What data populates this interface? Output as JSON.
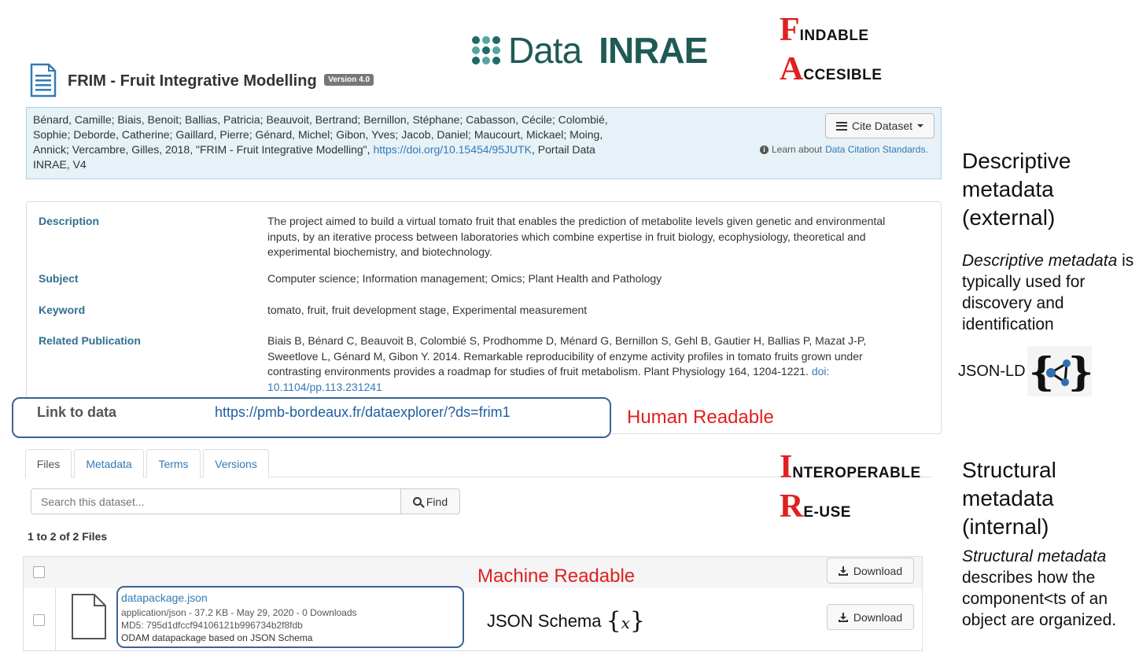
{
  "header": {
    "title": "FRIM - Fruit Integrative Modelling",
    "version": "Version 4.0",
    "logo_data": "Data",
    "logo_inrae": "INRAE"
  },
  "fair": {
    "findable_initial": "F",
    "findable_rest": "INDABLE",
    "accessible_initial": "A",
    "accessible_rest": "CCESIBLE",
    "interoperable_initial": "I",
    "interoperable_rest": "NTEROPERABLE",
    "reuse_initial": "R",
    "reuse_rest": "E-USE"
  },
  "citation": {
    "authors_text": "Bénard, Camille; Biais, Benoit; Ballias, Patricia; Beauvoit, Bertrand; Bernillon, Stéphane; Cabasson, Cécile; Colombié, Sophie; Deborde, Catherine; Gaillard, Pierre; Génard, Michel; Gibon, Yves; Jacob, Daniel; Maucourt, Mickael; Moing, Annick; Vercambre, Gilles, 2018, \"FRIM - Fruit Integrative Modelling\", ",
    "doi_link": "https://doi.org/10.15454/95JUTK",
    "suffix": ", Portail Data INRAE, V4",
    "cite_button": "Cite Dataset",
    "learn_prefix": "Learn about ",
    "learn_link": "Data Citation Standards."
  },
  "metadata": {
    "description_label": "Description",
    "description": "The project aimed to build a virtual tomato fruit that enables the prediction of metabolite levels given genetic and environmental inputs, by an iterative process between laboratories which combine expertise in fruit biology, ecophysiology, theoretical and experimental biochemistry, and biotechnology.",
    "subject_label": "Subject",
    "subject": "Computer science; Information management; Omics; Plant Health and Pathology",
    "keyword_label": "Keyword",
    "keyword": "tomato, fruit, fruit development stage, Experimental measurement",
    "related_label": "Related Publication",
    "related_text": "Biais B, Bénard C, Beauvoit B, Colombié S, Prodhomme D, Ménard G, Bernillon S, Gehl B, Gautier H, Ballias P, Mazat J-P, Sweetlove L, Génard M, Gibon Y. 2014. Remarkable reproducibility of enzyme activity profiles in tomato fruits grown under contrasting environments provides a roadmap for studies of fruit metabolism. Plant Physiology 164, 1204-1221. ",
    "related_doi": "doi: 10.1104/pp.113.231241",
    "link_label": "Link to data",
    "link_url": "https://pmb-bordeaux.fr/dataexplorer/?ds=frim1"
  },
  "annotations": {
    "human_readable": "Human Readable",
    "machine_readable": "Machine Readable",
    "json_schema": "JSON Schema",
    "json_ld": "JSON-LD",
    "descriptive_heading": [
      "Descriptive",
      "metadata",
      "(external)"
    ],
    "descriptive_em": "Descriptive metadata",
    "descriptive_text": " is typically used for discovery and identification",
    "structural_heading": [
      "Structural",
      "metadata",
      "(internal)"
    ],
    "structural_em": "Structural metadata",
    "structural_text": " describes how the component<ts of an object are organized."
  },
  "tabs": [
    "Files",
    "Metadata",
    "Terms",
    "Versions"
  ],
  "search": {
    "placeholder": "Search this dataset...",
    "button": "Find"
  },
  "files": {
    "count": "1 to 2 of 2 Files",
    "download_label": "Download",
    "item": {
      "name": "datapackage.json",
      "info": "application/json - 37.2 KB - May 29, 2020 - 0 Downloads",
      "md5": "MD5: 795d1dfccf94106121b996734b2f8fdb",
      "description": "ODAM datapackage based on JSON Schema"
    }
  },
  "colors": {
    "accent_red": "#e02020",
    "link_blue": "#337ab7",
    "inrae_green": "#1f5a55",
    "annotation_box": "#3b6390"
  }
}
